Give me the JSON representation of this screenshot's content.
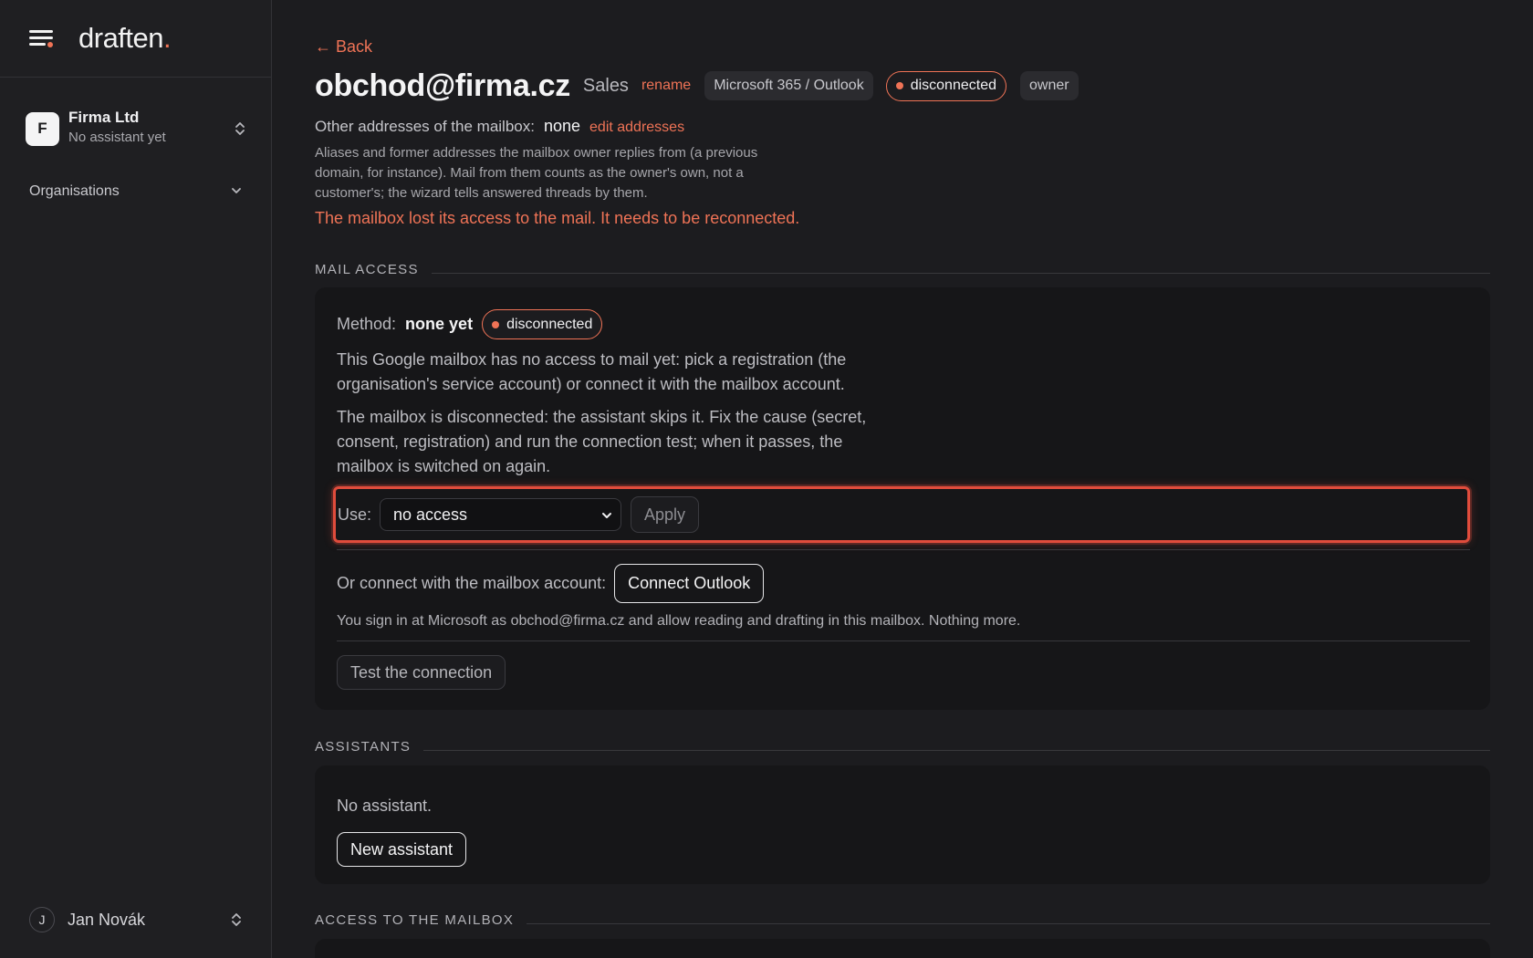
{
  "sidebar": {
    "logo_text": "draften",
    "logo_dot": ".",
    "org": {
      "initial": "F",
      "name": "Firma Ltd",
      "subtitle": "No assistant yet"
    },
    "nav": [
      {
        "label": "Organisations"
      }
    ],
    "user": {
      "initial": "J",
      "name": "Jan Novák"
    }
  },
  "main": {
    "back_label": "← Back",
    "title": "obchod@firma.cz",
    "label": "Sales",
    "rename_label": "rename",
    "provider_chip": "Microsoft 365 / Outlook",
    "status": "disconnected",
    "role_chip": "owner",
    "addresses": {
      "label": "Other addresses of the mailbox:",
      "value": "none",
      "edit_label": "edit addresses",
      "help": "Aliases and former addresses the mailbox owner replies from (a previous domain, for instance). Mail from them counts as the owner's own, not a customer's; the wizard tells answered threads by them."
    },
    "error": "The mailbox lost its access to the mail. It needs to be reconnected."
  },
  "mail_access": {
    "heading": "MAIL ACCESS",
    "method_label": "Method:",
    "method_value": "none yet",
    "status": "disconnected",
    "para_1": "This Google mailbox has no access to mail yet: pick a registration (the organisation's service account) or connect it with the mailbox account.",
    "para_2": "The mailbox is disconnected: the assistant skips it. Fix the cause (secret, consent, registration) and run the connection test; when it passes, the mailbox is switched on again.",
    "use_label": "Use:",
    "select_value": "no access",
    "apply_label": "Apply",
    "connect_label": "Or connect with the mailbox account:",
    "connect_button": "Connect Outlook",
    "connect_help": "You sign in at Microsoft as obchod@firma.cz and allow reading and drafting in this mailbox. Nothing more.",
    "test_button": "Test the connection"
  },
  "assistants": {
    "heading": "ASSISTANTS",
    "empty_text": "No assistant.",
    "new_button": "New assistant"
  },
  "mailbox_access": {
    "heading": "ACCESS TO THE MAILBOX"
  },
  "colors": {
    "accent": "#ef7356",
    "highlight": "#e04c3c",
    "background": "#1c1c1f",
    "card": "#161618"
  }
}
